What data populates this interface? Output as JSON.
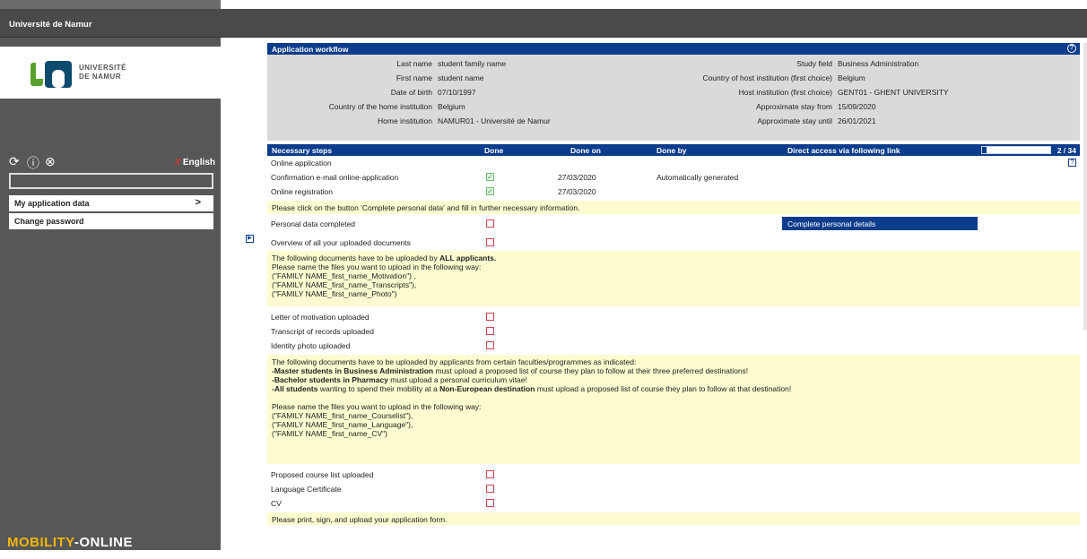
{
  "header": {
    "university": "Université de Namur"
  },
  "sidebar": {
    "logo_line1": "UNIVERSITÉ",
    "logo_line2": "DE NAMUR",
    "language": "English",
    "menu": [
      {
        "label": "My application data",
        "chevron": ">"
      },
      {
        "label": "Change password"
      }
    ],
    "footer_brand_left": "MOBILITY",
    "footer_brand_right": "ONLINE"
  },
  "workflow": {
    "title": "Application workflow",
    "help": "?",
    "info_left": [
      {
        "label": "Last name",
        "value": "student family name"
      },
      {
        "label": "First name",
        "value": "student name"
      },
      {
        "label": "Date of birth",
        "value": "07/10/1997"
      },
      {
        "label": "Country of the home institution",
        "value": "Belgium"
      },
      {
        "label": "Home institution",
        "value": "NAMUR01 - Université de Namur"
      }
    ],
    "info_right": [
      {
        "label": "Study field",
        "value": "Business Administration"
      },
      {
        "label": "Country of host institution (first choice)",
        "value": "Belgium"
      },
      {
        "label": "Host institution (first choice)",
        "value": "GENT01 - GHENT UNIVERSITY"
      },
      {
        "label": "Approximate stay from",
        "value": "15/09/2020"
      },
      {
        "label": "Approximate stay until",
        "value": "26/01/2021"
      }
    ]
  },
  "steps": {
    "col_steps": "Necessary steps",
    "col_done": "Done",
    "col_done_on": "Done on",
    "col_done_by": "Done by",
    "col_link": "Direct access via following link",
    "progress_value": 0.06,
    "progress_text": "2 / 34",
    "online_application": "Online application",
    "confirmation": {
      "label": "Confirmation e-mail online-application",
      "date": "27/03/2020",
      "by": "Automatically generated"
    },
    "registration": {
      "label": "Online registration",
      "date": "27/03/2020"
    },
    "note_personal": "Please click on the button 'Complete personal data' and fill in further necessary information.",
    "personal_data": "Personal data completed",
    "complete_button": "Complete personal details",
    "overview_docs": "Overview of all your uploaded documents",
    "all_docs_intro_pre": "The following documents have to be uploaded by ",
    "all_docs_intro_strong": "ALL applicants.",
    "all_docs_lines": [
      "Please name the files you want to upload in the following way:",
      "(\"FAMILY NAME_first_name_Motivation\") ,",
      "(\"FAMILY NAME_first_name_Transcripts\"),",
      "(\"FAMILY NAME_first_name_Photo\")"
    ],
    "motivation": "Letter of motivation uploaded",
    "transcript": "Transcript of records uploaded",
    "photo": "Identity photo uploaded",
    "fac_intro": "The following documents have to be uploaded by applicants from certain faculties/programmes as indicated:",
    "fac_line1_strong": "-Master students in Business Administration",
    "fac_line1_rest": " must upload a proposed list of course they plan to follow at their three preferred destinations!",
    "fac_line2_strong": "-Bachelor students in Pharmacy",
    "fac_line2_rest": " must upload a personal curriculum vitae!",
    "fac_line3_strong1": "-All students",
    "fac_line3_mid": " wanting to spend their mobility at a ",
    "fac_line3_strong2": "Non-European destination",
    "fac_line3_rest": " must upload a proposed list of course they plan to follow at that destination!",
    "fac_lines2": [
      "Please name the files you want to upload in the following way:",
      "(\"FAMILY NAME_first_name_Courselist\"),",
      "(\"FAMILY NAME_first_name_Language\"),",
      "(\"FAMILY NAME_first_name_CV\")"
    ],
    "course_list": "Proposed course list uploaded",
    "language_cert": "Language Certificate",
    "cv": "CV",
    "note_print": "Please print, sign, and upload your application form."
  }
}
